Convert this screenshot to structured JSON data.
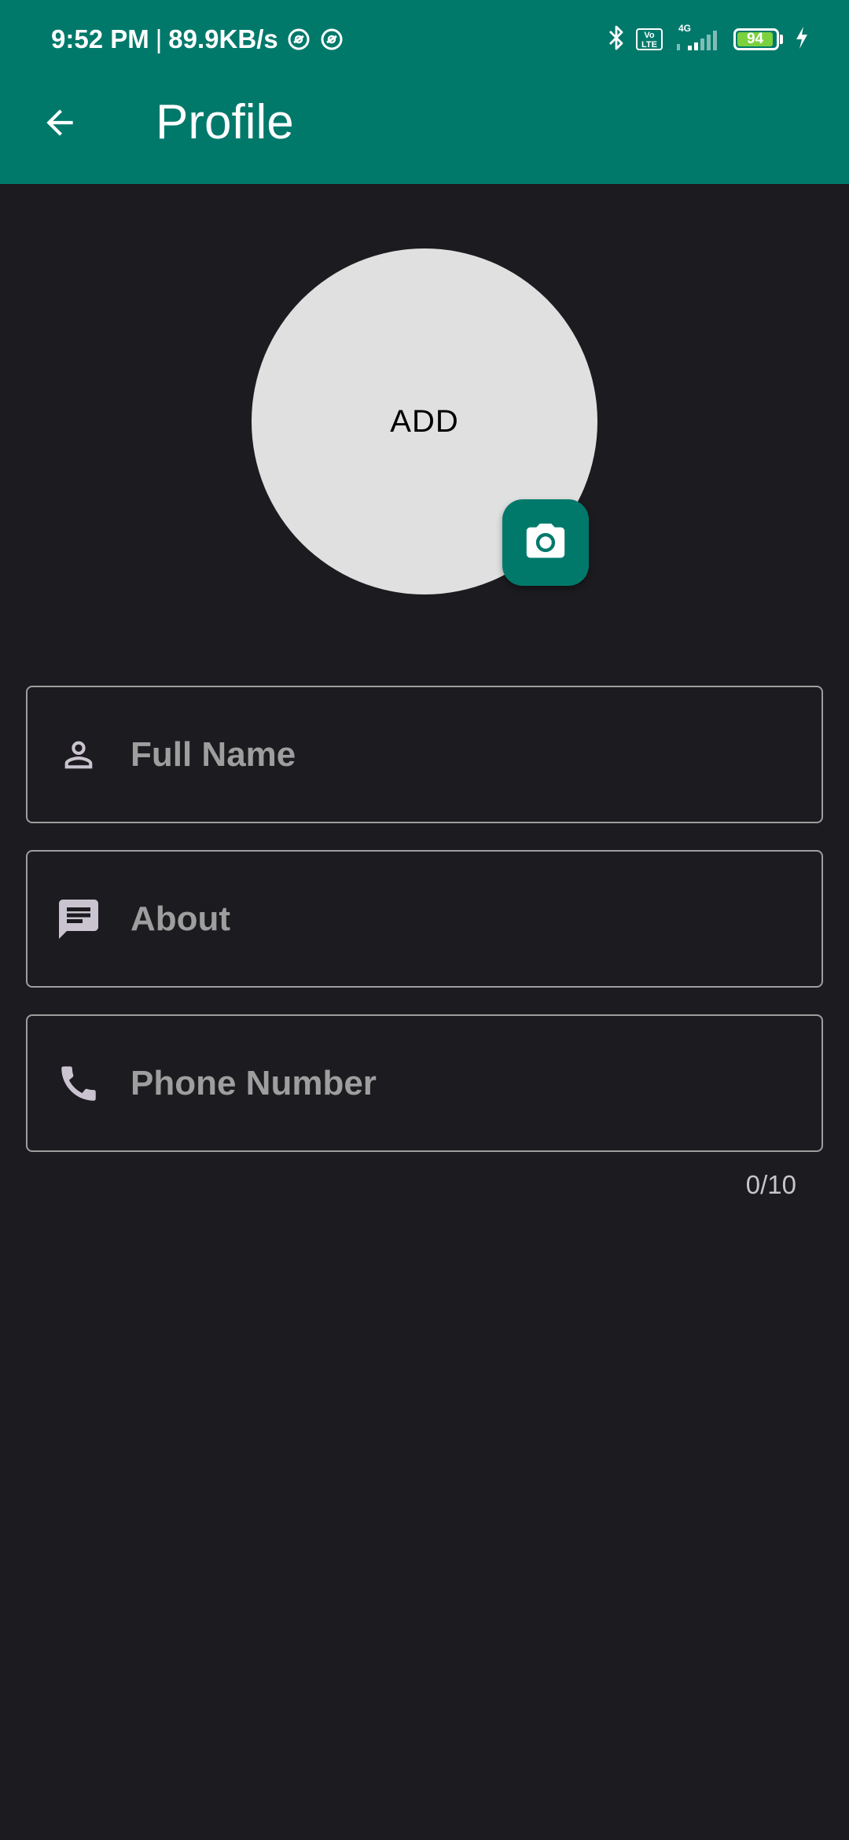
{
  "status_bar": {
    "time": "9:52 PM",
    "separator": "|",
    "network_speed": "89.9KB/s",
    "network_type": "4G",
    "volte_label": "Vo LTE",
    "battery_level": "94"
  },
  "app_bar": {
    "title": "Profile",
    "back_icon": "arrow-back-icon",
    "color": "#00796b"
  },
  "avatar": {
    "label": "ADD",
    "camera_icon": "camera-icon"
  },
  "form": {
    "full_name": {
      "value": "",
      "placeholder": "Full Name",
      "icon": "person-icon"
    },
    "about": {
      "value": "",
      "placeholder": "About",
      "icon": "message-icon"
    },
    "phone": {
      "value": "",
      "placeholder": "Phone Number",
      "icon": "phone-icon",
      "counter": "0/10"
    }
  }
}
